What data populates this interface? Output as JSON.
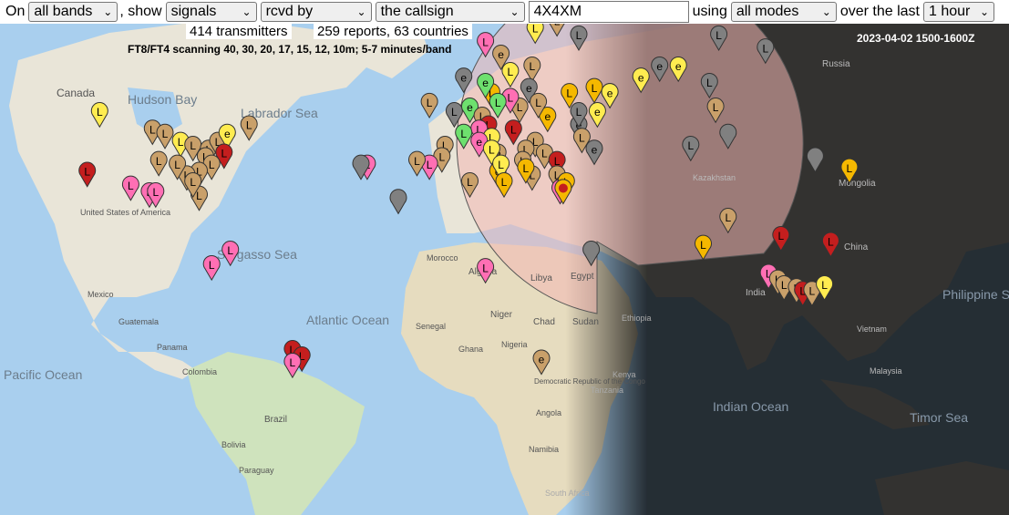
{
  "toolbar": {
    "on_label": "On",
    "band": "all bands",
    "show_label": ", show",
    "signals": "signals",
    "direction": "rcvd by",
    "target": "the callsign",
    "callsign": "4X4XM",
    "using_label": "using",
    "mode": "all modes",
    "over_label": "over the last",
    "period": "1 hour"
  },
  "stats": {
    "transmitters": "414 transmitters",
    "reports": "259 reports, 63 countries",
    "scan_note": "FT8/FT4 scanning 40, 30, 20, 17, 15, 12, 10m; 5-7 minutes/band"
  },
  "datestamp": "2023-04-02 1500-1600Z",
  "map_labels": {
    "canada": "Canada",
    "hudson_bay": "Hudson Bay",
    "labrador_sea": "Labrador Sea",
    "united_states": "United States of America",
    "sargasso_sea": "Sargasso Sea",
    "mexico": "Mexico",
    "guatemala": "Guatemala",
    "panama": "Panama",
    "colombia": "Colombia",
    "pacific_ocean": "Pacific Ocean",
    "atlantic_ocean": "Atlantic Ocean",
    "brazil": "Brazil",
    "bolivia": "Bolivia",
    "paraguay": "Paraguay",
    "morocco": "Morocco",
    "algeria": "Algeria",
    "libya": "Libya",
    "egypt": "Egypt",
    "niger": "Niger",
    "chad": "Chad",
    "sudan": "Sudan",
    "senegal": "Senegal",
    "nigeria": "Nigeria",
    "ghana": "Ghana",
    "ethiopia": "Ethiopia",
    "kenya": "Kenya",
    "drc": "Democratic Republic of the Congo",
    "tanzania": "Tanzania",
    "angola": "Angola",
    "namibia": "Namibia",
    "south_africa": "South Africa",
    "russia": "Russia",
    "kazakhstan": "Kazakhstan",
    "mongolia": "Mongolia",
    "china": "China",
    "india": "India",
    "indian_ocean": "Indian Ocean",
    "philippine_sea": "Philippine Sea",
    "vietnam": "Vietnam",
    "malaysia": "Malaysia",
    "timor_sea": "Timor Sea",
    "mexico_state": "Mexico"
  },
  "colors": {
    "ocean": "#a9cfee",
    "land": "#e9e5d8",
    "land_green": "#cfe3bd",
    "night_ocean": "#1d2a36",
    "night_land": "#3b3d3a",
    "range_fill": "#f3b8b4",
    "marker_tan": "#c9a06a",
    "marker_pink": "#ff6fb4",
    "marker_red": "#c41e1e",
    "marker_yellow": "#ffec50",
    "marker_orange": "#f5b800",
    "marker_green": "#6ee06e",
    "marker_gray": "#808080"
  },
  "markers": [
    {
      "lat": 53,
      "lon": -8,
      "color": "tan",
      "glyph": "L"
    },
    {
      "lat": 51,
      "lon": 0,
      "color": "gray",
      "glyph": "L"
    },
    {
      "lat": 52,
      "lon": 5,
      "color": "green",
      "glyph": "e"
    },
    {
      "lat": 50,
      "lon": 9,
      "color": "tan",
      "glyph": "L"
    },
    {
      "lat": 48,
      "lon": 11,
      "color": "red",
      "glyph": "L"
    },
    {
      "lat": 47,
      "lon": 8,
      "color": "pink",
      "glyph": "L"
    },
    {
      "lat": 45,
      "lon": 12,
      "color": "yellow",
      "glyph": "L"
    },
    {
      "lat": 41,
      "lon": 14,
      "color": "tan",
      "glyph": "e"
    },
    {
      "lat": 43,
      "lon": -3,
      "color": "tan",
      "glyph": "L"
    },
    {
      "lat": 40,
      "lon": -4,
      "color": "tan",
      "glyph": "L"
    },
    {
      "lat": 38,
      "lon": -8,
      "color": "pink",
      "glyph": "L"
    },
    {
      "lat": 55,
      "lon": 12,
      "color": "orange",
      "glyph": "L"
    },
    {
      "lat": 59,
      "lon": 18,
      "color": "yellow",
      "glyph": "L"
    },
    {
      "lat": 60,
      "lon": 25,
      "color": "tan",
      "glyph": "L"
    },
    {
      "lat": 56,
      "lon": 24,
      "color": "gray",
      "glyph": "e"
    },
    {
      "lat": 52,
      "lon": 21,
      "color": "tan",
      "glyph": "L"
    },
    {
      "lat": 50,
      "lon": 30,
      "color": "orange",
      "glyph": "e"
    },
    {
      "lat": 47,
      "lon": 19,
      "color": "red",
      "glyph": "L"
    },
    {
      "lat": 44,
      "lon": 26,
      "color": "tan",
      "glyph": "L"
    },
    {
      "lat": 42,
      "lon": 23,
      "color": "tan",
      "glyph": "L"
    },
    {
      "lat": 39,
      "lon": 22,
      "color": "tan",
      "glyph": "L"
    },
    {
      "lat": 36,
      "lon": 14,
      "color": "orange",
      "glyph": "e"
    },
    {
      "lat": 41,
      "lon": 29,
      "color": "tan",
      "glyph": "L"
    },
    {
      "lat": 39,
      "lon": 33,
      "color": "red",
      "glyph": "L"
    },
    {
      "lat": 35,
      "lon": 33,
      "color": "tan",
      "glyph": "L"
    },
    {
      "lat": 32,
      "lon": 35,
      "color": "red",
      "glyph": "L"
    },
    {
      "lat": 31,
      "lon": 34,
      "color": "pink",
      "glyph": "L"
    },
    {
      "lat": 55,
      "lon": 37,
      "color": "orange",
      "glyph": "L"
    },
    {
      "lat": 51,
      "lon": 46,
      "color": "yellow",
      "glyph": "e"
    },
    {
      "lat": 48,
      "lon": 40,
      "color": "gray",
      "glyph": "e"
    },
    {
      "lat": 45,
      "lon": 41,
      "color": "tan",
      "glyph": "L"
    },
    {
      "lat": 42,
      "lon": 45,
      "color": "gray",
      "glyph": "e"
    },
    {
      "lat": 55,
      "lon": 50,
      "color": "pink",
      "glyph": "e"
    },
    {
      "lat": 58,
      "lon": 60,
      "color": "yellow",
      "glyph": "e"
    },
    {
      "lat": 56,
      "lon": 45,
      "color": "orange",
      "glyph": "L"
    },
    {
      "lat": 65,
      "lon": 40,
      "color": "gray",
      "glyph": "L"
    },
    {
      "lat": 67,
      "lon": 33,
      "color": "tan",
      "glyph": "L"
    },
    {
      "lat": 66,
      "lon": 26,
      "color": "yellow",
      "glyph": "L"
    },
    {
      "lat": 62,
      "lon": 15,
      "color": "tan",
      "glyph": "e"
    },
    {
      "lat": 64,
      "lon": 10,
      "color": "pink",
      "glyph": "L"
    },
    {
      "lat": 69,
      "lon": 20,
      "color": "yellow",
      "glyph": "L"
    },
    {
      "lat": 70,
      "lon": 42,
      "color": "orange",
      "glyph": "L"
    },
    {
      "lat": 73,
      "lon": 50,
      "color": "gray",
      "glyph": "L"
    },
    {
      "lat": 72,
      "lon": 47,
      "color": "tan",
      "glyph": "L"
    },
    {
      "lat": 60,
      "lon": 66,
      "color": "gray",
      "glyph": "e"
    },
    {
      "lat": 57,
      "lon": 82,
      "color": "gray",
      "glyph": "L"
    },
    {
      "lat": 55,
      "lon": 50,
      "color": "yellow",
      "glyph": "e"
    },
    {
      "lat": 51,
      "lon": 40,
      "color": "gray",
      "glyph": "L"
    },
    {
      "lat": 53,
      "lon": 27,
      "color": "tan",
      "glyph": "L"
    },
    {
      "lat": 54,
      "lon": 18,
      "color": "pink",
      "glyph": "L"
    },
    {
      "lat": 57,
      "lon": 10,
      "color": "green",
      "glyph": "e"
    },
    {
      "lat": 58,
      "lon": 3,
      "color": "gray",
      "glyph": "e"
    },
    {
      "lat": 53,
      "lon": 14,
      "color": "green",
      "glyph": "L"
    },
    {
      "lat": 46,
      "lon": 3,
      "color": "green",
      "glyph": "L"
    },
    {
      "lat": 44,
      "lon": 8,
      "color": "pink",
      "glyph": "e"
    },
    {
      "lat": 42,
      "lon": 12,
      "color": "yellow",
      "glyph": "L"
    },
    {
      "lat": 38,
      "lon": 15,
      "color": "yellow",
      "glyph": "L"
    },
    {
      "lat": 35,
      "lon": 25,
      "color": "tan",
      "glyph": "L"
    },
    {
      "lat": 37,
      "lon": 23,
      "color": "orange",
      "glyph": "L"
    },
    {
      "lat": 33,
      "lon": 36,
      "color": "orange",
      "glyph": "L"
    },
    {
      "lat": 75,
      "lon": 40,
      "color": "yellow",
      "glyph": "L"
    },
    {
      "lat": 79,
      "lon": 70,
      "color": "orange",
      "glyph": "L"
    },
    {
      "lat": 80,
      "lon": 90,
      "color": "orange",
      "glyph": "L"
    },
    {
      "lat": 75,
      "lon": 30,
      "color": "yellow",
      "glyph": ""
    },
    {
      "lat": 74,
      "lon": 56,
      "color": "tan",
      "glyph": "L"
    },
    {
      "lat": 76,
      "lon": 62,
      "color": "gray",
      "glyph": "L"
    },
    {
      "lat": 65,
      "lon": 85,
      "color": "gray",
      "glyph": "L"
    },
    {
      "lat": 63,
      "lon": 100,
      "color": "gray",
      "glyph": "L"
    },
    {
      "lat": 60,
      "lon": 72,
      "color": "yellow",
      "glyph": "e"
    },
    {
      "lat": 52,
      "lon": 84,
      "color": "tan",
      "glyph": "L"
    },
    {
      "lat": 33,
      "lon": 5,
      "color": "tan",
      "glyph": "L"
    },
    {
      "lat": 33,
      "lon": 16,
      "color": "orange",
      "glyph": "L"
    },
    {
      "lat": 39,
      "lon": -12,
      "color": "tan",
      "glyph": "L"
    },
    {
      "lat": 28,
      "lon": -18,
      "color": "gray",
      "glyph": ""
    },
    {
      "lat": 38,
      "lon": -28,
      "color": "pink",
      "glyph": "L"
    },
    {
      "lat": 38,
      "lon": -30,
      "color": "gray",
      "glyph": ""
    },
    {
      "lat": 51,
      "lon": -114,
      "color": "yellow",
      "glyph": "L"
    },
    {
      "lat": 47,
      "lon": -97,
      "color": "tan",
      "glyph": "L"
    },
    {
      "lat": 46,
      "lon": -93,
      "color": "tan",
      "glyph": "L"
    },
    {
      "lat": 44,
      "lon": -88,
      "color": "yellow",
      "glyph": "L"
    },
    {
      "lat": 43,
      "lon": -84,
      "color": "tan",
      "glyph": "L"
    },
    {
      "lat": 42,
      "lon": -79,
      "color": "tan",
      "glyph": "L"
    },
    {
      "lat": 44,
      "lon": -76,
      "color": "tan",
      "glyph": "L"
    },
    {
      "lat": 46,
      "lon": -73,
      "color": "yellow",
      "glyph": "e"
    },
    {
      "lat": 48,
      "lon": -66,
      "color": "tan",
      "glyph": "L"
    },
    {
      "lat": 41,
      "lon": -74,
      "color": "red",
      "glyph": "L"
    },
    {
      "lat": 40,
      "lon": -80,
      "color": "tan",
      "glyph": "L"
    },
    {
      "lat": 38,
      "lon": -78,
      "color": "tan",
      "glyph": "L"
    },
    {
      "lat": 36,
      "lon": -82,
      "color": "tan",
      "glyph": "L"
    },
    {
      "lat": 35,
      "lon": -86,
      "color": "tan",
      "glyph": "L"
    },
    {
      "lat": 38,
      "lon": -89,
      "color": "tan",
      "glyph": "L"
    },
    {
      "lat": 39,
      "lon": -95,
      "color": "tan",
      "glyph": "L"
    },
    {
      "lat": 36,
      "lon": -118,
      "color": "red",
      "glyph": "L"
    },
    {
      "lat": 32,
      "lon": -104,
      "color": "pink",
      "glyph": "L"
    },
    {
      "lat": 30,
      "lon": -98,
      "color": "pink",
      "glyph": "L"
    },
    {
      "lat": 30,
      "lon": -96,
      "color": "pink",
      "glyph": "L"
    },
    {
      "lat": 29,
      "lon": -82,
      "color": "tan",
      "glyph": "L"
    },
    {
      "lat": 33,
      "lon": -84,
      "color": "tan",
      "glyph": "L"
    },
    {
      "lat": 11,
      "lon": -72,
      "color": "pink",
      "glyph": "L"
    },
    {
      "lat": 6,
      "lon": -78,
      "color": "pink",
      "glyph": "L"
    },
    {
      "lat": -23,
      "lon": -52,
      "color": "red",
      "glyph": "L"
    },
    {
      "lat": -25,
      "lon": -49,
      "color": "red",
      "glyph": "L"
    },
    {
      "lat": -27,
      "lon": -52,
      "color": "pink",
      "glyph": "L"
    },
    {
      "lat": 5,
      "lon": 10,
      "color": "pink",
      "glyph": "L"
    },
    {
      "lat": 11,
      "lon": 44,
      "color": "gray",
      "glyph": ""
    },
    {
      "lat": -26,
      "lon": 28,
      "color": "tan",
      "glyph": "e"
    },
    {
      "lat": 43,
      "lon": 76,
      "color": "gray",
      "glyph": "L"
    },
    {
      "lat": 46,
      "lon": 88,
      "color": "gray",
      "glyph": ""
    },
    {
      "lat": 40,
      "lon": 116,
      "color": "gray",
      "glyph": ""
    },
    {
      "lat": 37,
      "lon": 127,
      "color": "orange",
      "glyph": "L"
    },
    {
      "lat": 22,
      "lon": 88,
      "color": "tan",
      "glyph": "L"
    },
    {
      "lat": 13,
      "lon": 80,
      "color": "orange",
      "glyph": "L"
    },
    {
      "lat": 16,
      "lon": 105,
      "color": "red",
      "glyph": "L"
    },
    {
      "lat": 14,
      "lon": 121,
      "color": "red",
      "glyph": "L"
    },
    {
      "lat": 3,
      "lon": 101,
      "color": "pink",
      "glyph": "L"
    },
    {
      "lat": 1,
      "lon": 104,
      "color": "tan",
      "glyph": "L"
    },
    {
      "lat": -1,
      "lon": 106,
      "color": "tan",
      "glyph": "L"
    },
    {
      "lat": -2,
      "lon": 110,
      "color": "tan",
      "glyph": "L"
    },
    {
      "lat": -3,
      "lon": 112,
      "color": "red",
      "glyph": "L"
    },
    {
      "lat": -3,
      "lon": 115,
      "color": "tan",
      "glyph": "L"
    },
    {
      "lat": -1,
      "lon": 119,
      "color": "yellow",
      "glyph": "L"
    },
    {
      "lat": 31,
      "lon": 35,
      "color": "orange",
      "glyph": "home"
    }
  ]
}
